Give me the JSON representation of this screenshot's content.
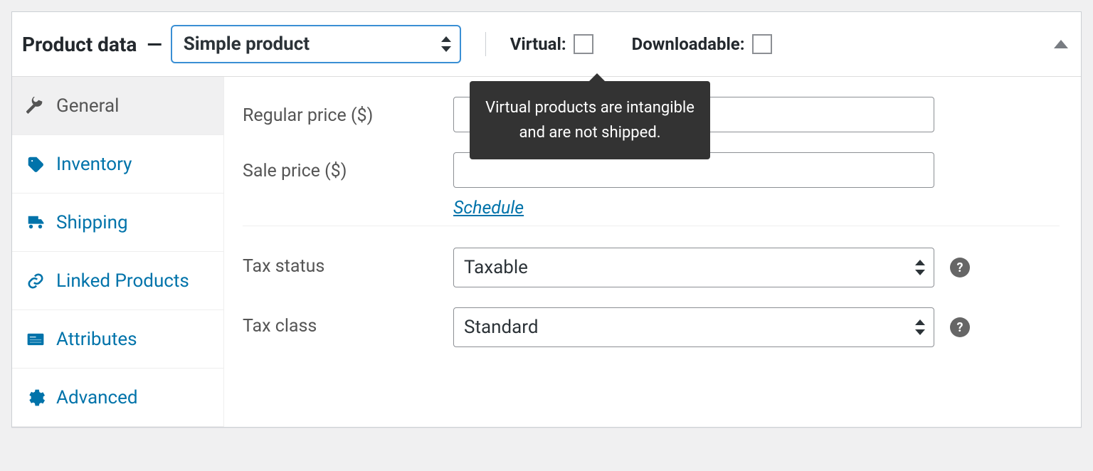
{
  "header": {
    "title": "Product data",
    "dash": "—",
    "product_type": "Simple product",
    "virtual_label": "Virtual:",
    "downloadable_label": "Downloadable:",
    "tooltip": "Virtual products are intangible and are not shipped."
  },
  "tabs": {
    "general": "General",
    "inventory": "Inventory",
    "shipping": "Shipping",
    "linked": "Linked Products",
    "attributes": "Attributes",
    "advanced": "Advanced"
  },
  "fields": {
    "regular_price_label": "Regular price ($)",
    "regular_price_value": "",
    "sale_price_label": "Sale price ($)",
    "sale_price_value": "",
    "schedule_link": "Schedule",
    "tax_status_label": "Tax status",
    "tax_status_value": "Taxable",
    "tax_class_label": "Tax class",
    "tax_class_value": "Standard",
    "help_glyph": "?"
  },
  "colors": {
    "link": "#0073aa",
    "focus_border": "#3a8fd4",
    "tooltip_bg": "#333333"
  }
}
